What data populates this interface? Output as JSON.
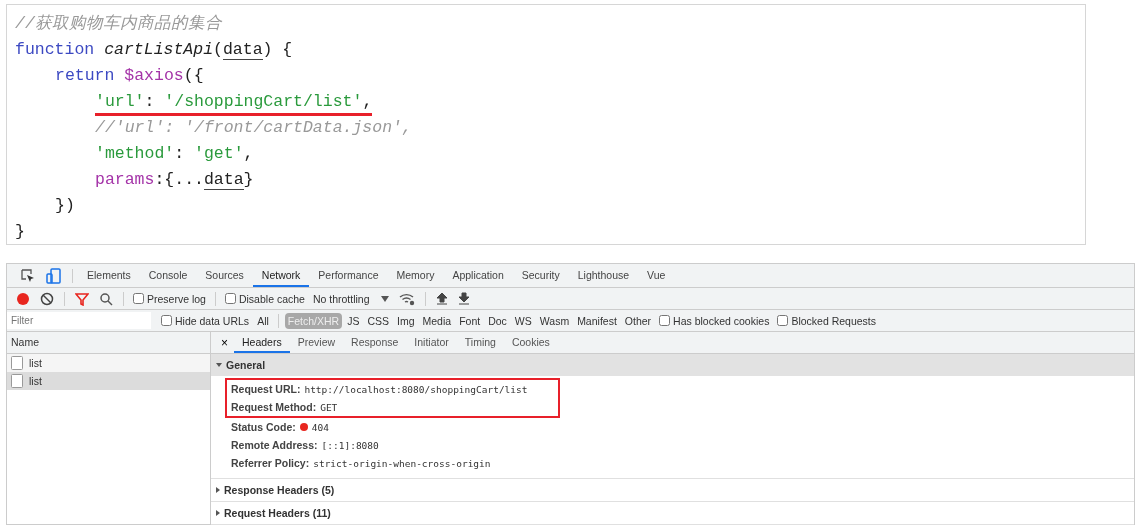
{
  "code": {
    "lines": [
      {
        "marked": false,
        "tokens": [
          {
            "kind": "comment",
            "text": "//获取购物车内商品的集合"
          }
        ]
      },
      {
        "marked": false,
        "tokens": [
          {
            "kind": "keyword",
            "text": "function "
          },
          {
            "kind": "fn",
            "text": "cartListApi"
          },
          {
            "kind": "plain",
            "text": "("
          },
          {
            "kind": "param",
            "text": "data"
          },
          {
            "kind": "plain",
            "text": ") {"
          }
        ],
        "children": [
          {
            "marked": false,
            "tokens": [
              {
                "kind": "keyword",
                "text": "return "
              },
              {
                "kind": "purple",
                "text": "$axios"
              },
              {
                "kind": "plain",
                "text": "({"
              }
            ],
            "children": [
              {
                "marked": true,
                "tokens": [
                  {
                    "kind": "string",
                    "text": "'url'"
                  },
                  {
                    "kind": "plain",
                    "text": ": "
                  },
                  {
                    "kind": "string",
                    "text": "'/shoppingCart/list'"
                  },
                  {
                    "kind": "plain",
                    "text": ","
                  }
                ]
              },
              {
                "marked": false,
                "tokens": [
                  {
                    "kind": "comment",
                    "text": "//'url': '/front/cartData.json',"
                  }
                ]
              },
              {
                "marked": false,
                "tokens": [
                  {
                    "kind": "string",
                    "text": "'method'"
                  },
                  {
                    "kind": "plain",
                    "text": ": "
                  },
                  {
                    "kind": "string",
                    "text": "'get'"
                  },
                  {
                    "kind": "plain",
                    "text": ","
                  }
                ]
              },
              {
                "marked": false,
                "tokens": [
                  {
                    "kind": "purple",
                    "text": "params"
                  },
                  {
                    "kind": "plain",
                    "text": ":{..."
                  },
                  {
                    "kind": "param",
                    "text": "data"
                  },
                  {
                    "kind": "plain",
                    "text": "}"
                  }
                ]
              }
            ]
          },
          {
            "marked": false,
            "tokens": [
              {
                "kind": "plain",
                "text": "})"
              }
            ]
          }
        ]
      },
      {
        "marked": false,
        "tokens": [
          {
            "kind": "plain",
            "text": "}"
          }
        ]
      }
    ]
  },
  "devtools": {
    "tabs": [
      {
        "label": "Elements",
        "selected": false
      },
      {
        "label": "Console",
        "selected": false
      },
      {
        "label": "Sources",
        "selected": false
      },
      {
        "label": "Network",
        "selected": true
      },
      {
        "label": "Performance",
        "selected": false
      },
      {
        "label": "Memory",
        "selected": false
      },
      {
        "label": "Application",
        "selected": false
      },
      {
        "label": "Security",
        "selected": false
      },
      {
        "label": "Lighthouse",
        "selected": false
      },
      {
        "label": "Vue",
        "selected": false
      }
    ],
    "toolbar": {
      "preserve_log": {
        "label": "Preserve log",
        "checked": false
      },
      "disable_cache": {
        "label": "Disable cache",
        "checked": false
      },
      "throttling": "No throttling"
    },
    "filter": {
      "placeholder": "Filter",
      "hide_data_urls": {
        "label": "Hide data URLs",
        "checked": false
      },
      "types": [
        {
          "label": "All",
          "selected": false
        },
        {
          "label": "Fetch/XHR",
          "selected": true
        },
        {
          "label": "JS",
          "selected": false
        },
        {
          "label": "CSS",
          "selected": false
        },
        {
          "label": "Img",
          "selected": false
        },
        {
          "label": "Media",
          "selected": false
        },
        {
          "label": "Font",
          "selected": false
        },
        {
          "label": "Doc",
          "selected": false
        },
        {
          "label": "WS",
          "selected": false
        },
        {
          "label": "Wasm",
          "selected": false
        },
        {
          "label": "Manifest",
          "selected": false
        },
        {
          "label": "Other",
          "selected": false
        }
      ],
      "options": [
        {
          "label": "Has blocked cookies",
          "checked": false
        },
        {
          "label": "Blocked Requests",
          "checked": false
        }
      ]
    },
    "requests": {
      "column": "Name",
      "rows": [
        {
          "name": "list",
          "selected": false
        },
        {
          "name": "list",
          "selected": true
        }
      ]
    },
    "detail": {
      "close": "×",
      "tabs": [
        {
          "label": "Headers",
          "selected": true
        },
        {
          "label": "Preview",
          "selected": false
        },
        {
          "label": "Response",
          "selected": false
        },
        {
          "label": "Initiator",
          "selected": false
        },
        {
          "label": "Timing",
          "selected": false
        },
        {
          "label": "Cookies",
          "selected": false
        }
      ],
      "sections": [
        {
          "title": "General",
          "expanded": true,
          "rows": [
            {
              "key": "Request URL:",
              "value": "http://localhost:8080/shoppingCart/list",
              "marked": true
            },
            {
              "key": "Request Method:",
              "value": "GET",
              "marked": true
            },
            {
              "key": "Status Code:",
              "value": "404",
              "marked": false,
              "color": "#e8261f"
            },
            {
              "key": "Remote Address:",
              "value": "[::1]:8080",
              "marked": false
            },
            {
              "key": "Referrer Policy:",
              "value": "strict-origin-when-cross-origin",
              "marked": false
            }
          ]
        },
        {
          "title": "Response Headers (5)",
          "expanded": false
        },
        {
          "title": "Request Headers (11)",
          "expanded": false
        }
      ]
    }
  }
}
